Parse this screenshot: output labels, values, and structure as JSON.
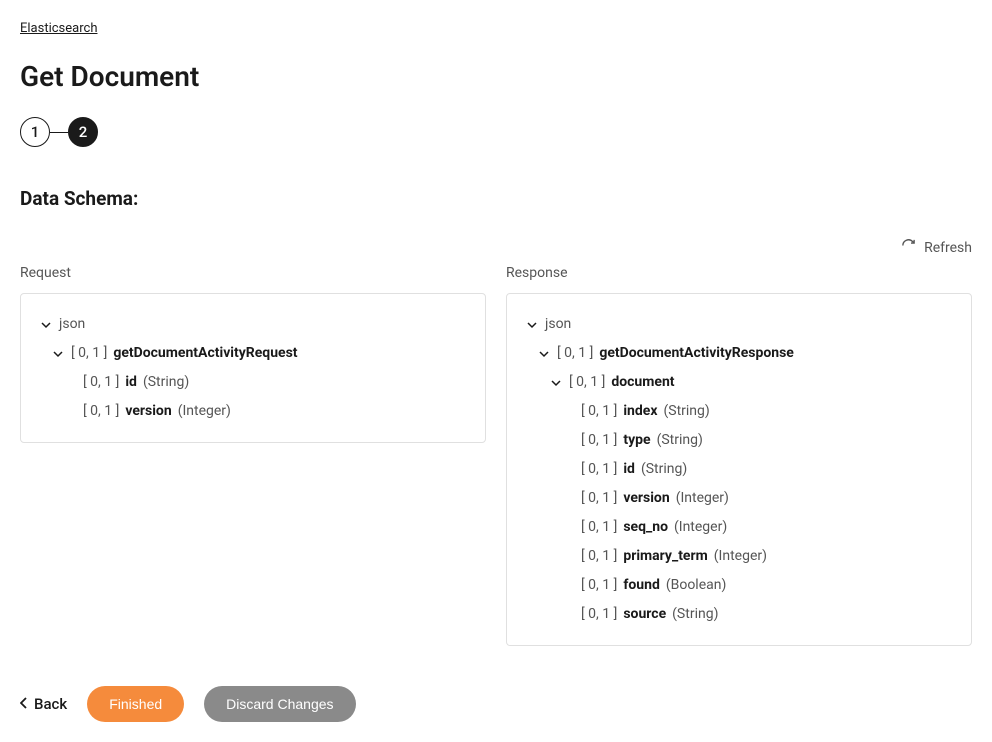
{
  "breadcrumb": "Elasticsearch",
  "title": "Get Document",
  "stepper": {
    "step1": "1",
    "step2": "2"
  },
  "section_heading": "Data Schema:",
  "refresh_label": "Refresh",
  "request": {
    "heading": "Request",
    "root": "json",
    "root_card": "[ 0, 1 ]",
    "root_name": "getDocumentActivityRequest",
    "fields": [
      {
        "card": "[ 0, 1 ]",
        "name": "id",
        "type": "(String)"
      },
      {
        "card": "[ 0, 1 ]",
        "name": "version",
        "type": "(Integer)"
      }
    ]
  },
  "response": {
    "heading": "Response",
    "root": "json",
    "root_card": "[ 0, 1 ]",
    "root_name": "getDocumentActivityResponse",
    "doc_card": "[ 0, 1 ]",
    "doc_name": "document",
    "fields": [
      {
        "card": "[ 0, 1 ]",
        "name": "index",
        "type": "(String)"
      },
      {
        "card": "[ 0, 1 ]",
        "name": "type",
        "type": "(String)"
      },
      {
        "card": "[ 0, 1 ]",
        "name": "id",
        "type": "(String)"
      },
      {
        "card": "[ 0, 1 ]",
        "name": "version",
        "type": "(Integer)"
      },
      {
        "card": "[ 0, 1 ]",
        "name": "seq_no",
        "type": "(Integer)"
      },
      {
        "card": "[ 0, 1 ]",
        "name": "primary_term",
        "type": "(Integer)"
      },
      {
        "card": "[ 0, 1 ]",
        "name": "found",
        "type": "(Boolean)"
      },
      {
        "card": "[ 0, 1 ]",
        "name": "source",
        "type": "(String)"
      }
    ]
  },
  "actions": {
    "back": "Back",
    "finished": "Finished",
    "discard": "Discard Changes"
  }
}
